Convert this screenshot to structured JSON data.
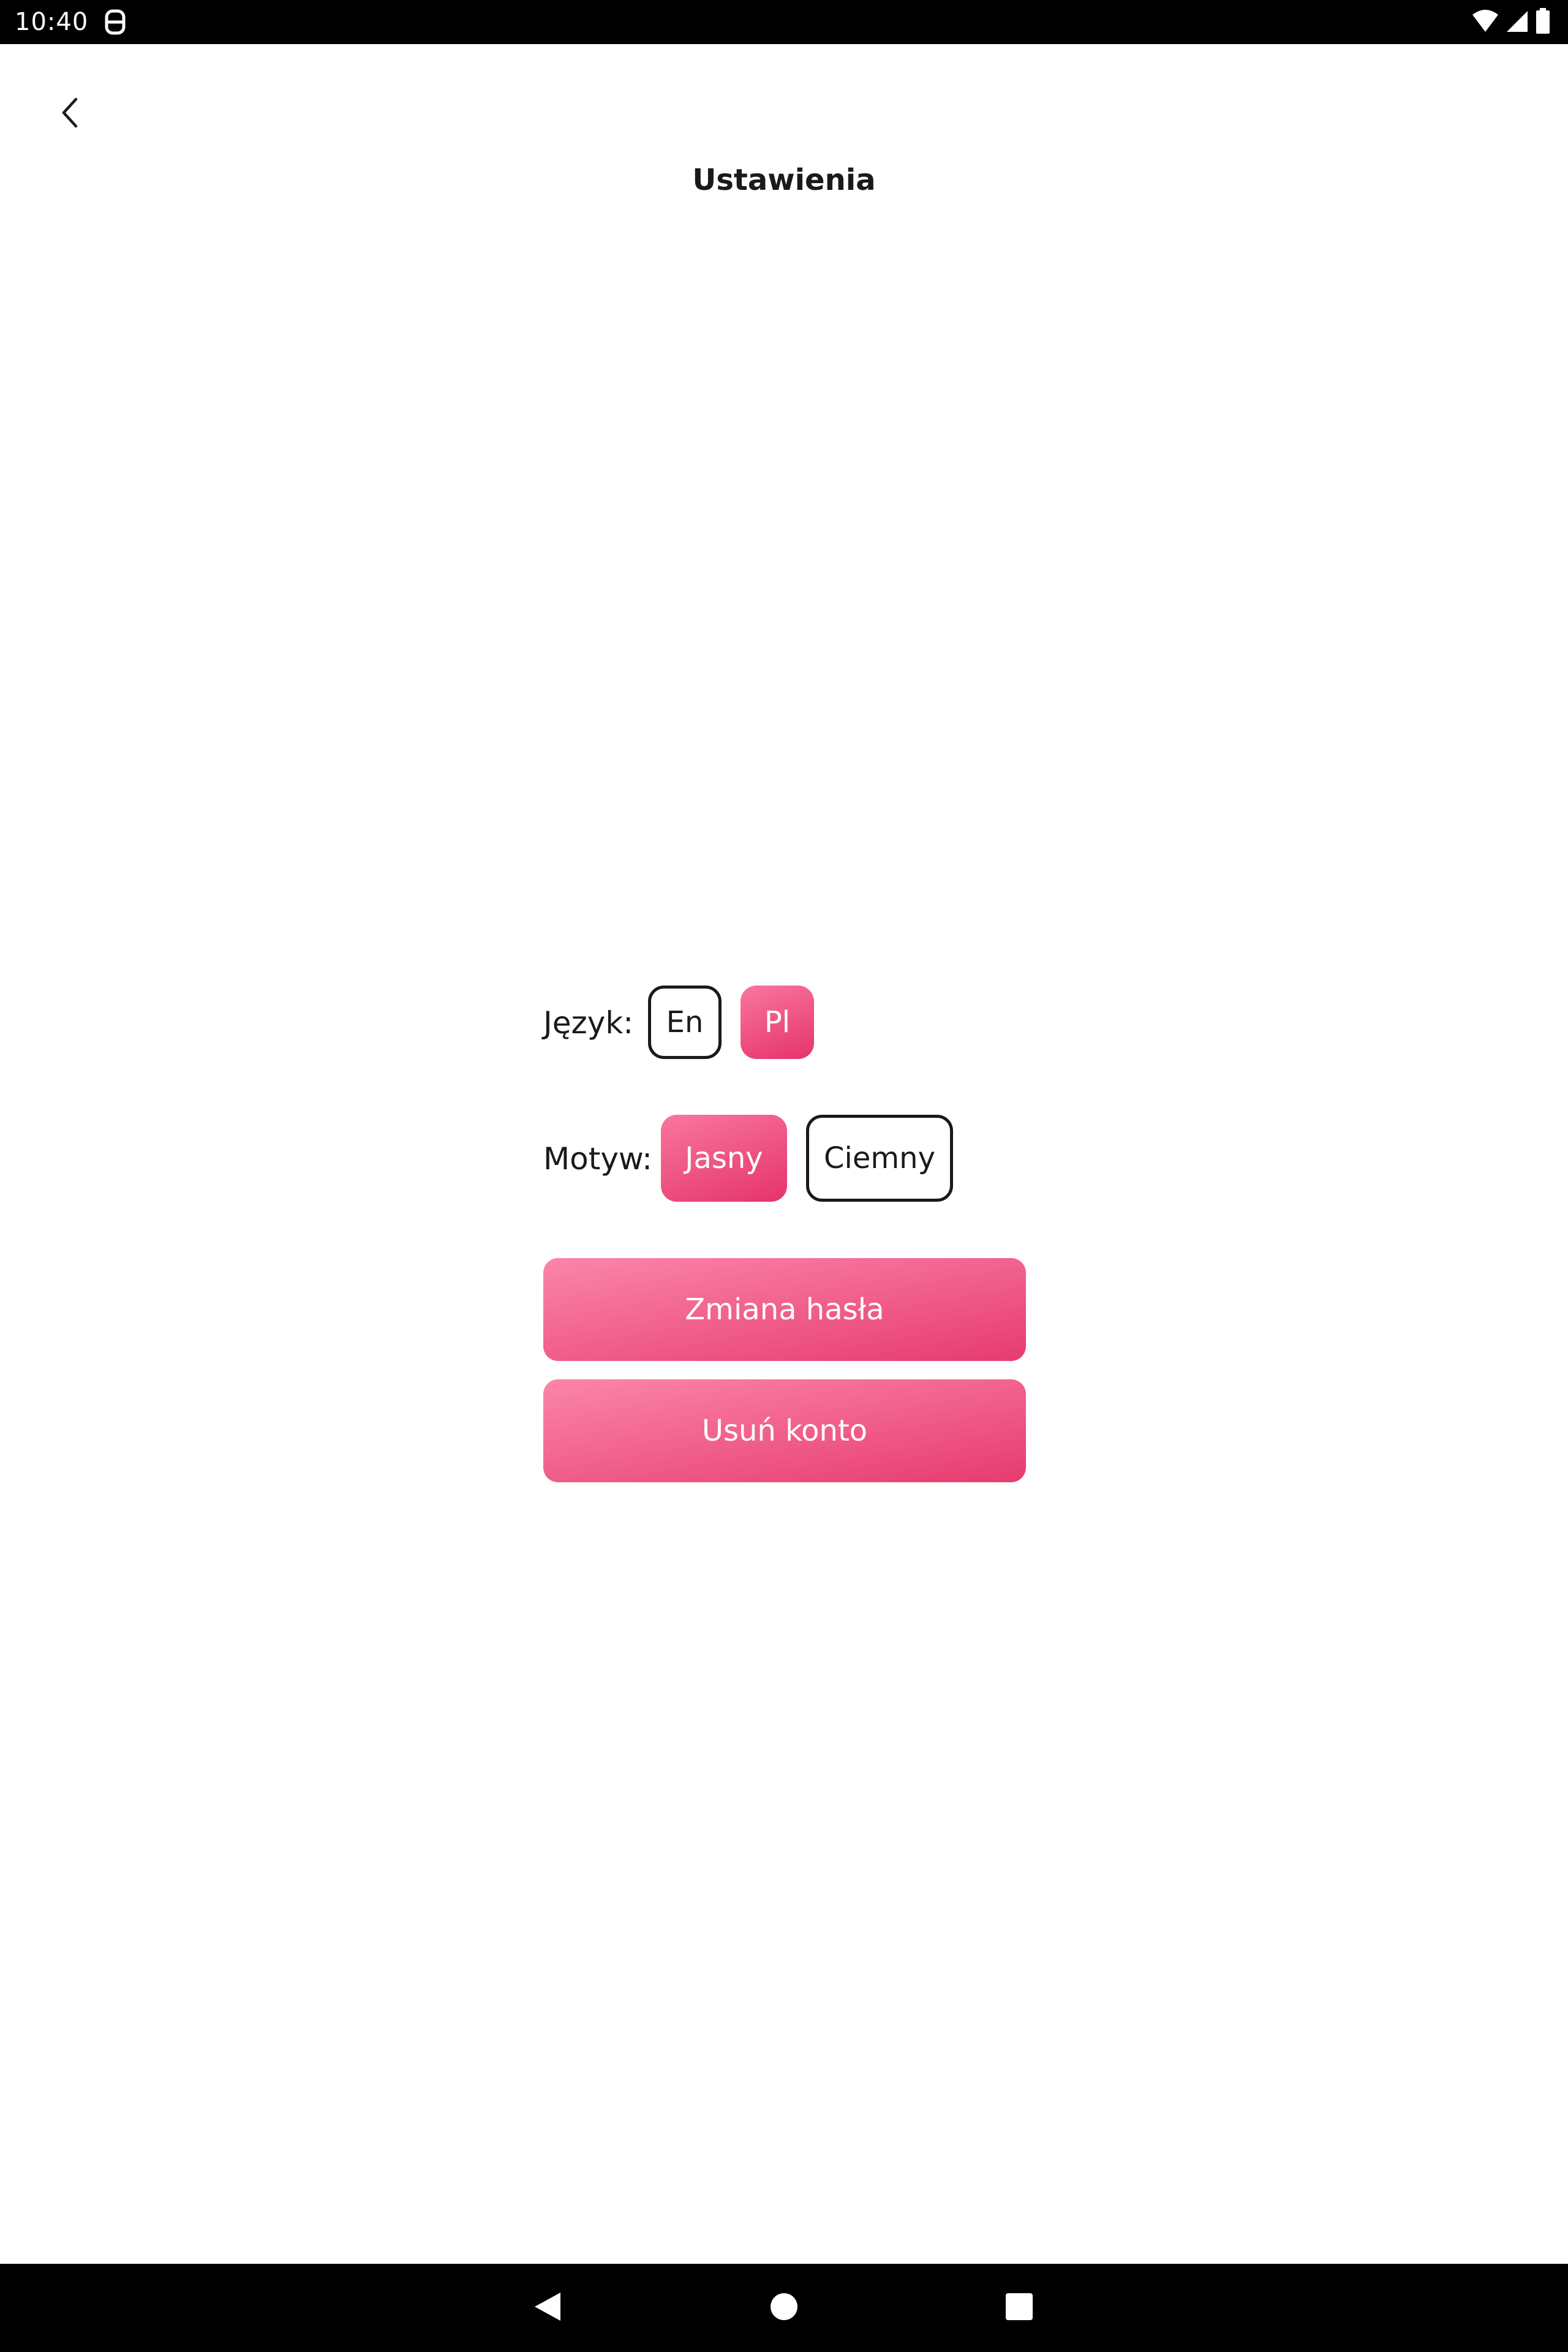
{
  "status_bar": {
    "time": "10:40",
    "icons": [
      "notification-icon",
      "wifi-icon",
      "signal-icon",
      "battery-icon"
    ]
  },
  "header": {
    "back_icon": "chevron-left-icon",
    "title": "Ustawienia"
  },
  "settings": {
    "language": {
      "label": "Język:",
      "options": [
        {
          "label": "En",
          "selected": false
        },
        {
          "label": "Pl",
          "selected": true
        }
      ]
    },
    "theme": {
      "label": "Motyw:",
      "options": [
        {
          "label": "Jasny",
          "selected": true
        },
        {
          "label": "Ciemny",
          "selected": false
        }
      ]
    },
    "change_password_label": "Zmiana hasła",
    "delete_account_label": "Usuń konto"
  },
  "nav_bar": {
    "icons": [
      "back-triangle-icon",
      "home-circle-icon",
      "recents-square-icon"
    ]
  },
  "colors": {
    "accent_start": "#f9779f",
    "accent_end": "#e5336b",
    "outline": "#1a1a1a"
  }
}
